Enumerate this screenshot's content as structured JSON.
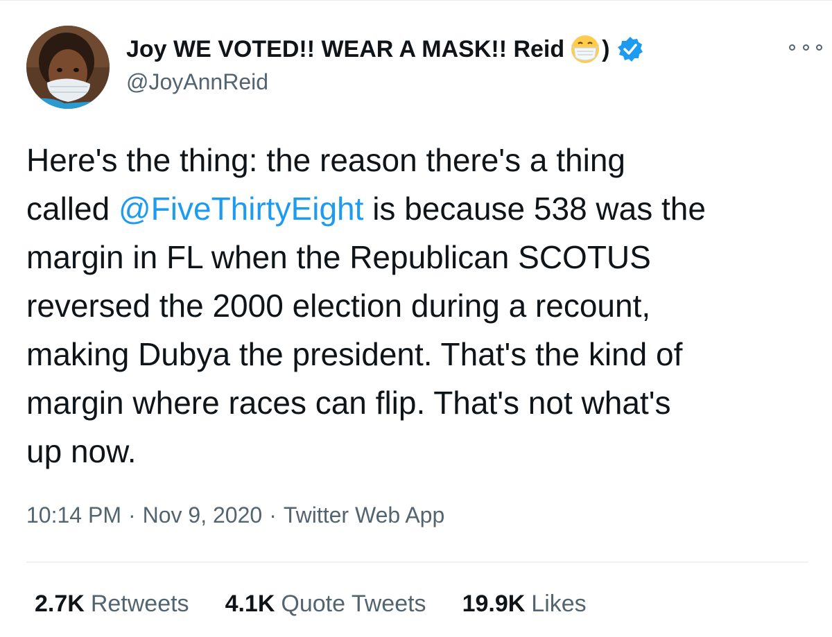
{
  "author": {
    "display_name": "Joy WE VOTED!! WEAR A MASK!! Reid",
    "name_suffix": ")",
    "handle": "@JoyAnnReid",
    "verified": true,
    "avatar_icon": "profile-photo",
    "name_emoji_icon": "face-with-medical-mask-emoji"
  },
  "tweet": {
    "lines": [
      {
        "before": "Here's the thing: the reason there's a thing",
        "mention": "",
        "after": ""
      },
      {
        "before": "called ",
        "mention": "@FiveThirtyEight",
        "after": " is because 538 was the"
      },
      {
        "before": "margin in FL when the Republican SCOTUS",
        "mention": "",
        "after": ""
      },
      {
        "before": "reversed the 2000 election during a recount,",
        "mention": "",
        "after": ""
      },
      {
        "before": "making Dubya the president. That's the kind of",
        "mention": "",
        "after": ""
      },
      {
        "before": "margin where races can flip. That's not what's",
        "mention": "",
        "after": ""
      },
      {
        "before": "up now.",
        "mention": "",
        "after": ""
      }
    ]
  },
  "meta": {
    "time": "10:14 PM",
    "separator": "·",
    "date": "Nov 9, 2020",
    "source": "Twitter Web App"
  },
  "stats": {
    "retweets_count": "2.7K",
    "retweets_label": "Retweets",
    "quotes_count": "4.1K",
    "quotes_label": "Quote Tweets",
    "likes_count": "19.9K",
    "likes_label": "Likes"
  },
  "colors": {
    "text": "#0f1419",
    "secondary": "#536471",
    "link": "#1d9bf0",
    "verified_badge": "#1d9bf0"
  }
}
